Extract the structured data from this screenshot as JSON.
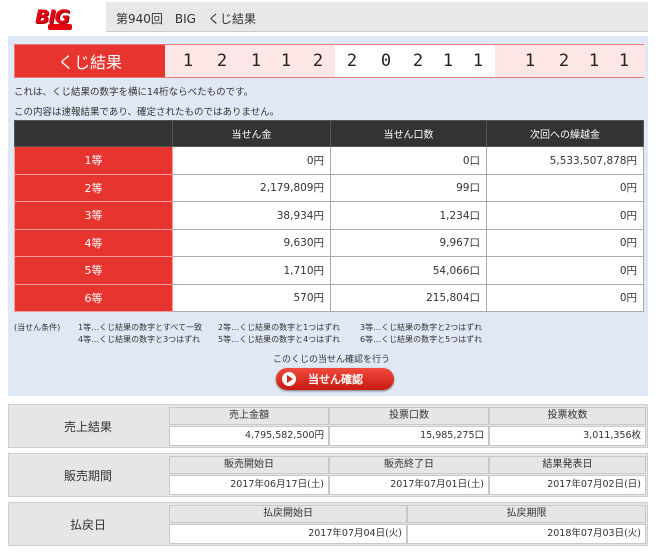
{
  "header": {
    "logo_text": "BIG",
    "title": "第940回　BIG　くじ結果"
  },
  "lottery": {
    "label": "くじ結果",
    "digits": [
      "1",
      "2",
      "1",
      "1",
      "2",
      "2",
      "0",
      "2",
      "1",
      "1",
      "1",
      "2",
      "1",
      "1"
    ]
  },
  "notes": {
    "line1": "これは、くじ結果の数字を横に14桁ならべたものです。",
    "line2": "この内容は速報結果であり、確定されたものではありません。"
  },
  "table": {
    "headers": [
      "",
      "当せん金",
      "当せん口数",
      "次回への繰越金"
    ],
    "rows": [
      {
        "grade": "1等",
        "prize": "0円",
        "count": "0口",
        "carryover": "5,533,507,878円"
      },
      {
        "grade": "2等",
        "prize": "2,179,809円",
        "count": "99口",
        "carryover": "0円"
      },
      {
        "grade": "3等",
        "prize": "38,934円",
        "count": "1,234口",
        "carryover": "0円"
      },
      {
        "grade": "4等",
        "prize": "9,630円",
        "count": "9,967口",
        "carryover": "0円"
      },
      {
        "grade": "5等",
        "prize": "1,710円",
        "count": "54,066口",
        "carryover": "0円"
      },
      {
        "grade": "6等",
        "prize": "570円",
        "count": "215,804口",
        "carryover": "0円"
      }
    ]
  },
  "conditions": {
    "label": "(当せん条件)",
    "c1": "1等…くじ結果の数字とすべて一致",
    "c2": "2等…くじ結果の数字と1つはずれ",
    "c3": "3等…くじ結果の数字と2つはずれ",
    "c4": "4等…くじ結果の数字と3つはずれ",
    "c5": "5等…くじ結果の数字と4つはずれ",
    "c6": "6等…くじ結果の数字と5つはずれ"
  },
  "check": {
    "text": "このくじの当せん確認を行う",
    "button": "当せん確認"
  },
  "sales": {
    "label": "売上結果",
    "h1": "売上金額",
    "h2": "投票口数",
    "h3": "投票枚数",
    "v1": "4,795,582,500円",
    "v2": "15,985,275口",
    "v3": "3,011,356枚"
  },
  "period": {
    "label": "販売期間",
    "h1": "販売開始日",
    "h2": "販売終了日",
    "h3": "結果発表日",
    "v1": "2017年06月17日(土)",
    "v2": "2017年07月01日(土)",
    "v3": "2017年07月02日(日)"
  },
  "payout": {
    "label": "払戻日",
    "h1": "払戻開始日",
    "h2": "払戻期限",
    "v1": "2017年07月04日(火)",
    "v2": "2018年07月03日(火)"
  },
  "colors": {
    "accent_red": "#e8342f",
    "panel_blue": "#dfe8f4",
    "table_header": "#333333"
  }
}
